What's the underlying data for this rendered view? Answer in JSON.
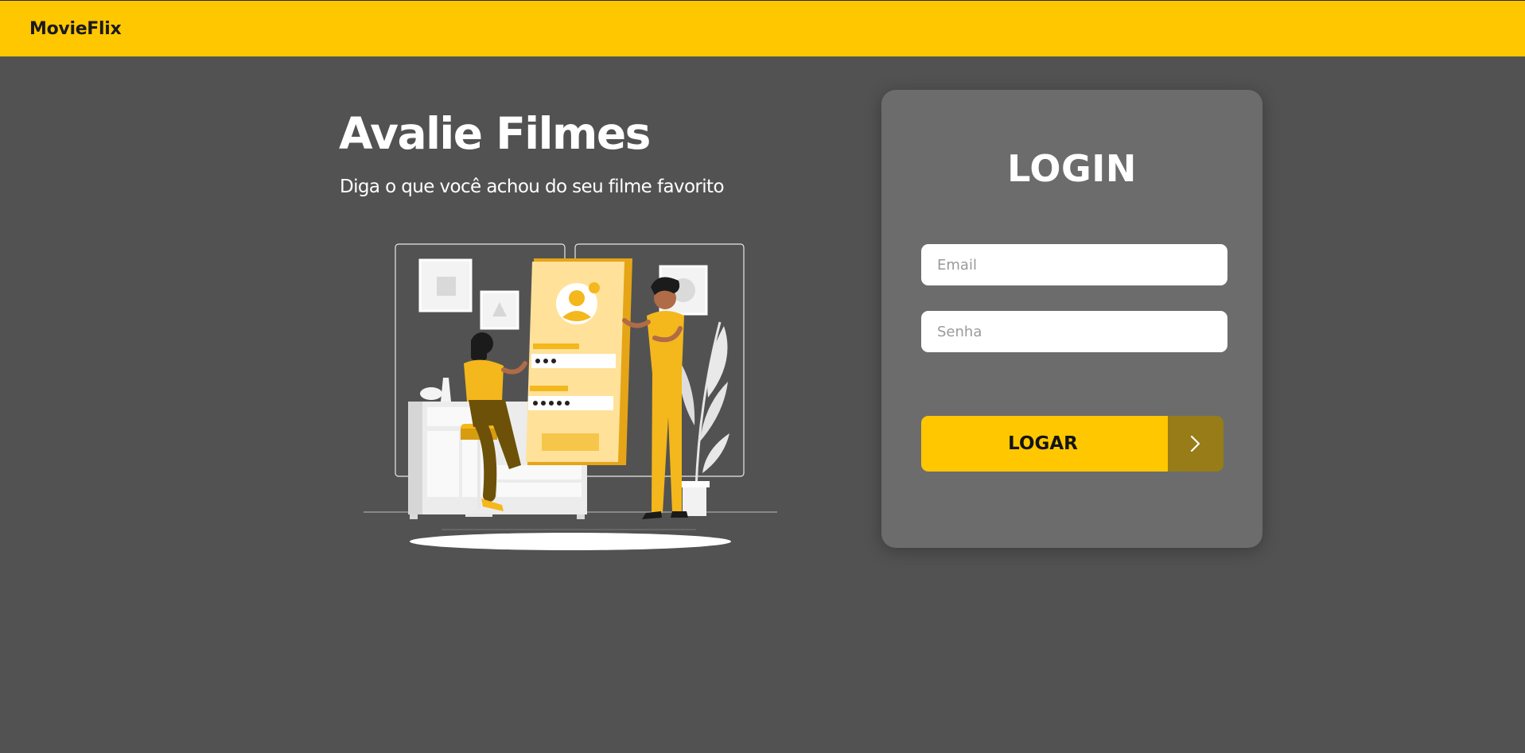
{
  "navbar": {
    "brand": "MovieFlix"
  },
  "hero": {
    "title": "Avalie Filmes",
    "subtitle": "Diga o que você achou do seu filme favorito"
  },
  "login": {
    "title": "LOGIN",
    "email": {
      "placeholder": "Email",
      "value": ""
    },
    "password": {
      "placeholder": "Senha",
      "value": ""
    },
    "submit_label": "LOGAR",
    "submit_icon": "chevron-right-icon"
  },
  "colors": {
    "accent": "#ffc700",
    "background": "#525252",
    "card": "#6c6c6c",
    "button_icon_bg": "#977c18"
  }
}
